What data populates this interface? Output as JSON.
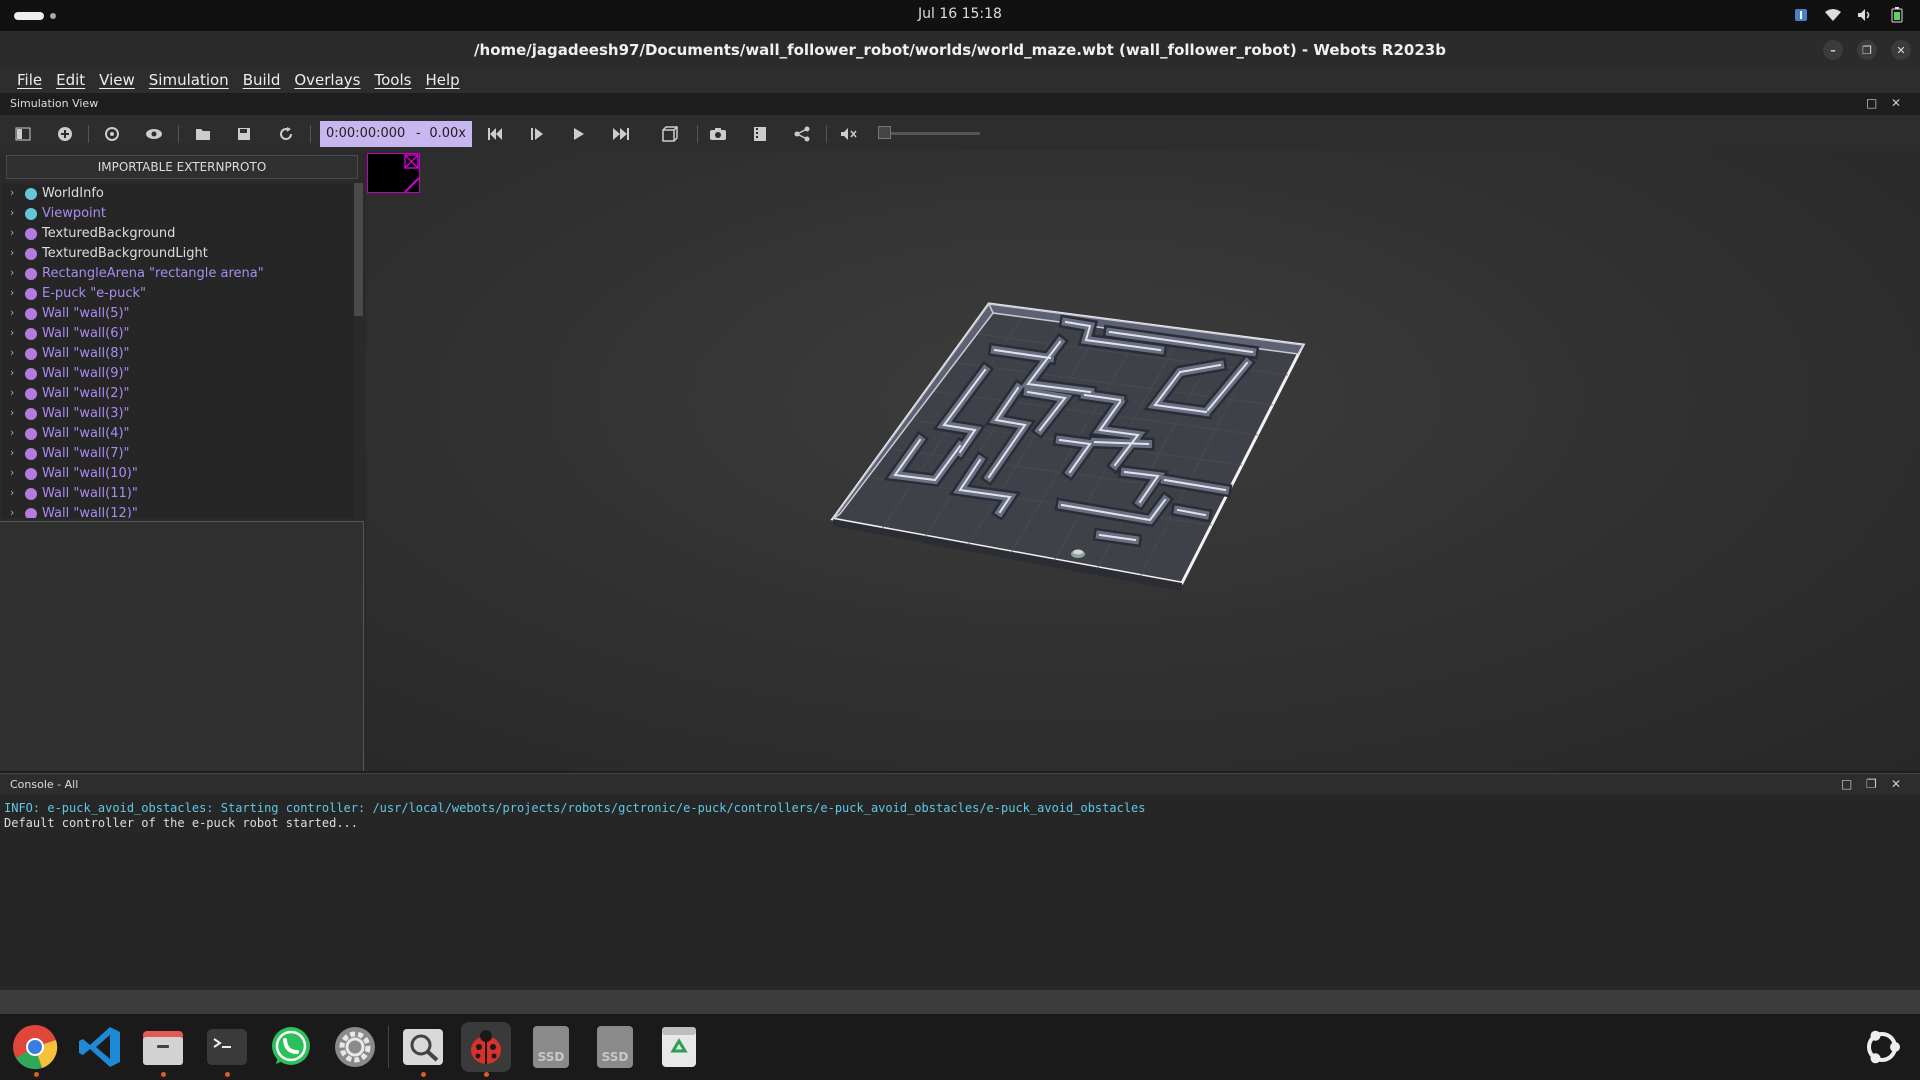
{
  "topbar": {
    "clock": "Jul 16  15:18"
  },
  "window": {
    "title": "/home/jagadeesh97/Documents/wall_follower_robot/worlds/world_maze.wbt (wall_follower_robot) - Webots R2023b"
  },
  "menu": [
    "File",
    "Edit",
    "View",
    "Simulation",
    "Build",
    "Overlays",
    "Tools",
    "Help"
  ],
  "simulation_view": {
    "label": "Simulation View",
    "time": "0:00:00:000",
    "time_sep": "-",
    "speed": "0.00x"
  },
  "scene_tree": {
    "importable_label": "IMPORTABLE EXTERNPROTO",
    "nodes": [
      {
        "name": "WorldInfo",
        "color": "#63c7d8"
      },
      {
        "name": "Viewpoint",
        "color": "#63c7d8",
        "text_color": "#a98bf0"
      },
      {
        "name": "TexturedBackground",
        "color": "#b57be0"
      },
      {
        "name": "TexturedBackgroundLight",
        "color": "#b57be0"
      },
      {
        "name": "RectangleArena \"rectangle arena\"",
        "color": "#b57be0",
        "text_color": "#a98bf0"
      },
      {
        "name": "E-puck \"e-puck\"",
        "color": "#b57be0",
        "text_color": "#a98bf0"
      },
      {
        "name": "Wall \"wall(5)\"",
        "color": "#b57be0",
        "text_color": "#a98bf0"
      },
      {
        "name": "Wall \"wall(6)\"",
        "color": "#b57be0",
        "text_color": "#a98bf0"
      },
      {
        "name": "Wall \"wall(8)\"",
        "color": "#b57be0",
        "text_color": "#a98bf0"
      },
      {
        "name": "Wall \"wall(9)\"",
        "color": "#b57be0",
        "text_color": "#a98bf0"
      },
      {
        "name": "Wall \"wall(2)\"",
        "color": "#b57be0",
        "text_color": "#a98bf0"
      },
      {
        "name": "Wall \"wall(3)\"",
        "color": "#b57be0",
        "text_color": "#a98bf0"
      },
      {
        "name": "Wall \"wall(4)\"",
        "color": "#b57be0",
        "text_color": "#a98bf0"
      },
      {
        "name": "Wall \"wall(7)\"",
        "color": "#b57be0",
        "text_color": "#a98bf0"
      },
      {
        "name": "Wall \"wall(10)\"",
        "color": "#b57be0",
        "text_color": "#a98bf0"
      },
      {
        "name": "Wall \"wall(11)\"",
        "color": "#b57be0",
        "text_color": "#a98bf0"
      },
      {
        "name": "Wall \"wall(12)\"",
        "color": "#b57be0",
        "text_color": "#a98bf0"
      }
    ]
  },
  "console": {
    "label": "Console - All",
    "lines": [
      "INFO: e-puck_avoid_obstacles: Starting controller: /usr/local/webots/projects/robots/gctronic/e-puck/controllers/e-puck_avoid_obstacles/e-puck_avoid_obstacles",
      "Default controller of the e-puck robot started..."
    ]
  },
  "dock": {
    "ssd1": "SSD",
    "ssd2": "SSD"
  }
}
